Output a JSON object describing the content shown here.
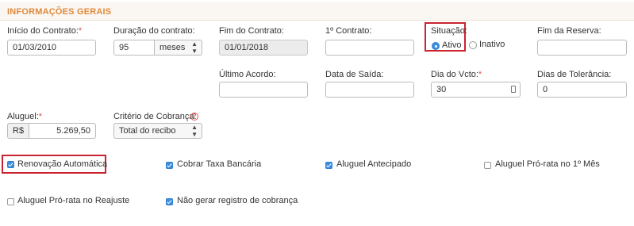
{
  "section": {
    "title": "INFORMAÇÕES GERAIS"
  },
  "fields": {
    "inicio": {
      "label": "Início do Contrato:",
      "required": "*",
      "value": "01/03/2010"
    },
    "duracao": {
      "label": "Duração do contrato:",
      "value": "95",
      "unit": "meses"
    },
    "fim_contrato": {
      "label": "Fim do Contrato:",
      "value": "01/01/2018"
    },
    "primeiro_contrato": {
      "label": "1º Contrato:",
      "value": ""
    },
    "situacao": {
      "label": "Situação:",
      "options": [
        "Ativo",
        "Inativo"
      ],
      "selected": "Ativo"
    },
    "fim_reserva": {
      "label": "Fim da Reserva:",
      "value": ""
    },
    "ultimo_acordo": {
      "label": "Último Acordo:",
      "value": ""
    },
    "data_saida": {
      "label": "Data de Saída:",
      "value": ""
    },
    "dia_vcto": {
      "label": "Dia do Vcto:",
      "required": "*",
      "value": "30"
    },
    "dias_tolerancia": {
      "label": "Dias de Tolerância:",
      "value": "0"
    },
    "aluguel": {
      "label": "Aluguel:",
      "required": "*",
      "currency": "R$",
      "value": "5.269,50"
    },
    "criterio": {
      "label": "Critério de Cobrança:",
      "value": "Total do recibo",
      "help": "?"
    }
  },
  "checkboxes": [
    {
      "label": "Renovação Automática",
      "checked": true
    },
    {
      "label": "Cobrar Taxa Bancária",
      "checked": true
    },
    {
      "label": "Aluguel Antecipado",
      "checked": true
    },
    {
      "label": "Aluguel Pró-rata no 1º Mês",
      "checked": false
    },
    {
      "label": "Aluguel Pró-rata no Reajuste",
      "checked": false
    },
    {
      "label": "Não gerar registro de cobrança",
      "checked": true
    }
  ],
  "colors": {
    "accent": "#e1893a",
    "required": "#d9534f",
    "highlight": "#c9232f",
    "check": "#3d8ee0"
  }
}
